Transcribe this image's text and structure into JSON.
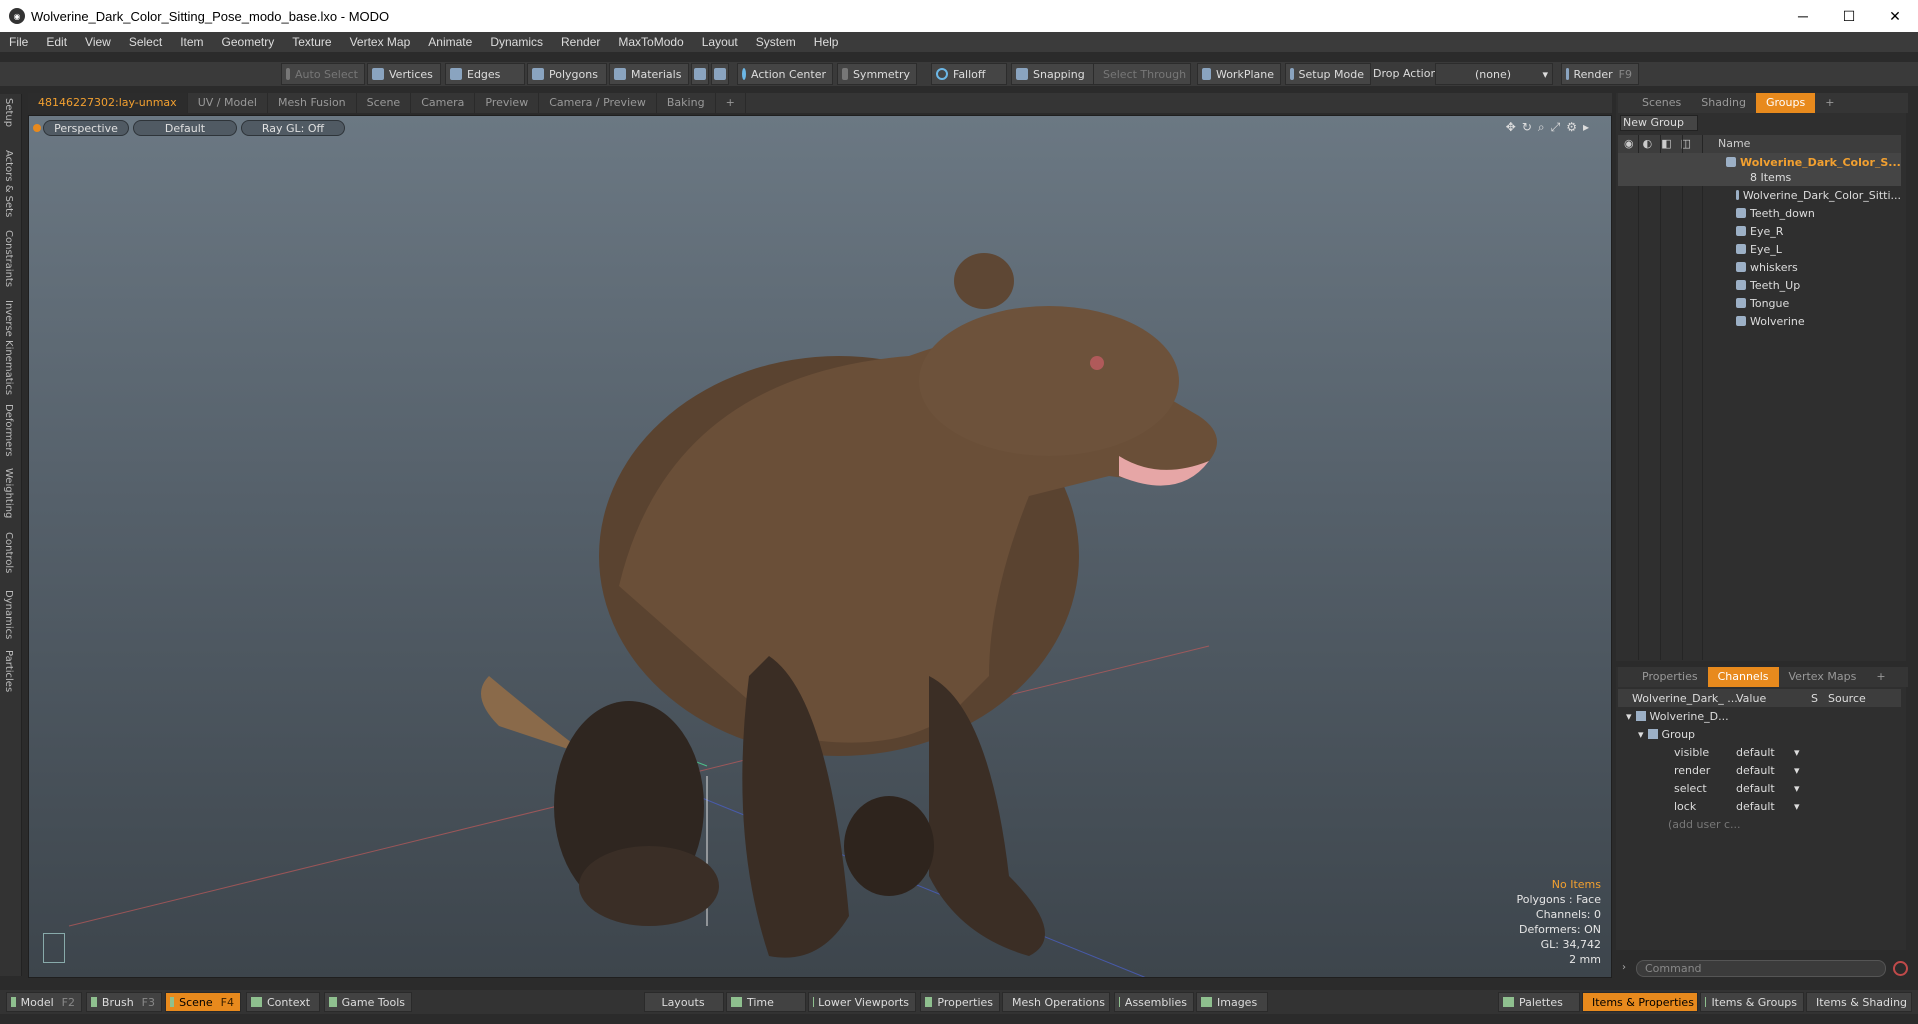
{
  "window": {
    "title": "Wolverine_Dark_Color_Sitting_Pose_modo_base.lxo - MODO",
    "minimize": "─",
    "maximize": "☐",
    "close": "✕"
  },
  "menu": [
    "File",
    "Edit",
    "View",
    "Select",
    "Item",
    "Geometry",
    "Texture",
    "Vertex Map",
    "Animate",
    "Dynamics",
    "Render",
    "MaxToModo",
    "Layout",
    "System",
    "Help"
  ],
  "toolbar": {
    "auto_select": "Auto Select",
    "vertices": "Vertices",
    "edges": "Edges",
    "polygons": "Polygons",
    "materials": "Materials",
    "action_center": "Action Center",
    "symmetry": "Symmetry",
    "falloff": "Falloff",
    "snapping": "Snapping",
    "select_through": "Select Through",
    "workplane": "WorkPlane",
    "setup_mode": "Setup Mode",
    "drop_action_label": "Drop Action",
    "drop_action_value": "(none)",
    "render": "Render",
    "render_key": "F9"
  },
  "left_tabs": [
    "Setup",
    "Actors & Sets",
    "Constraints",
    "Inverse Kinematics",
    "Deformers",
    "Weighting",
    "Controls",
    "Dynamics",
    "Particles"
  ],
  "viewport_tabs": [
    "48146227302:lay-unmax",
    "UV / Model",
    "Mesh Fusion",
    "Scene",
    "Camera",
    "Preview",
    "Camera / Preview",
    "Baking",
    "+"
  ],
  "viewport": {
    "perspective": "Perspective",
    "default": "Default",
    "raygl": "Ray GL: Off",
    "info": {
      "no_items": "No Items",
      "polygons": "Polygons : Face",
      "channels": "Channels: 0",
      "deformers": "Deformers: ON",
      "gl": "GL: 34,742",
      "scale": "2 mm"
    }
  },
  "groups_panel": {
    "tabs": [
      "Scenes",
      "Shading",
      "Groups",
      "+"
    ],
    "new_group": "New Group",
    "name_header": "Name",
    "root": "Wolverine_Dark_Color_S...",
    "count": "8 Items",
    "items": [
      "Wolverine_Dark_Color_Sitti...",
      "Teeth_down",
      "Eye_R",
      "Eye_L",
      "whiskers",
      "Teeth_Up",
      "Tongue",
      "Wolverine"
    ]
  },
  "channels_panel": {
    "tabs": [
      "Properties",
      "Channels",
      "Vertex Maps",
      "+"
    ],
    "headers": {
      "name": "Wolverine_Dark_ ...",
      "value": "Value",
      "s": "S",
      "source": "Source"
    },
    "root": "Wolverine_D...",
    "group": "Group",
    "rows": [
      {
        "name": "visible",
        "value": "default"
      },
      {
        "name": "render",
        "value": "default"
      },
      {
        "name": "select",
        "value": "default"
      },
      {
        "name": "lock",
        "value": "default"
      }
    ],
    "add_user": "(add user c...",
    "command_placeholder": "Command"
  },
  "bottom": {
    "model": "Model",
    "model_key": "F2",
    "brush": "Brush",
    "brush_key": "F3",
    "scene": "Scene",
    "scene_key": "F4",
    "context": "Context",
    "game_tools": "Game Tools",
    "layouts": "Layouts",
    "time": "Time",
    "lower_viewports": "Lower Viewports",
    "properties": "Properties",
    "mesh_operations": "Mesh Operations",
    "assemblies": "Assemblies",
    "images": "Images",
    "palettes": "Palettes",
    "items_properties": "Items & Properties",
    "items_groups": "Items & Groups",
    "items_shading": "Items & Shading"
  },
  "colors": {
    "accent": "#e88a1d",
    "highlight_text": "#f2a030"
  }
}
